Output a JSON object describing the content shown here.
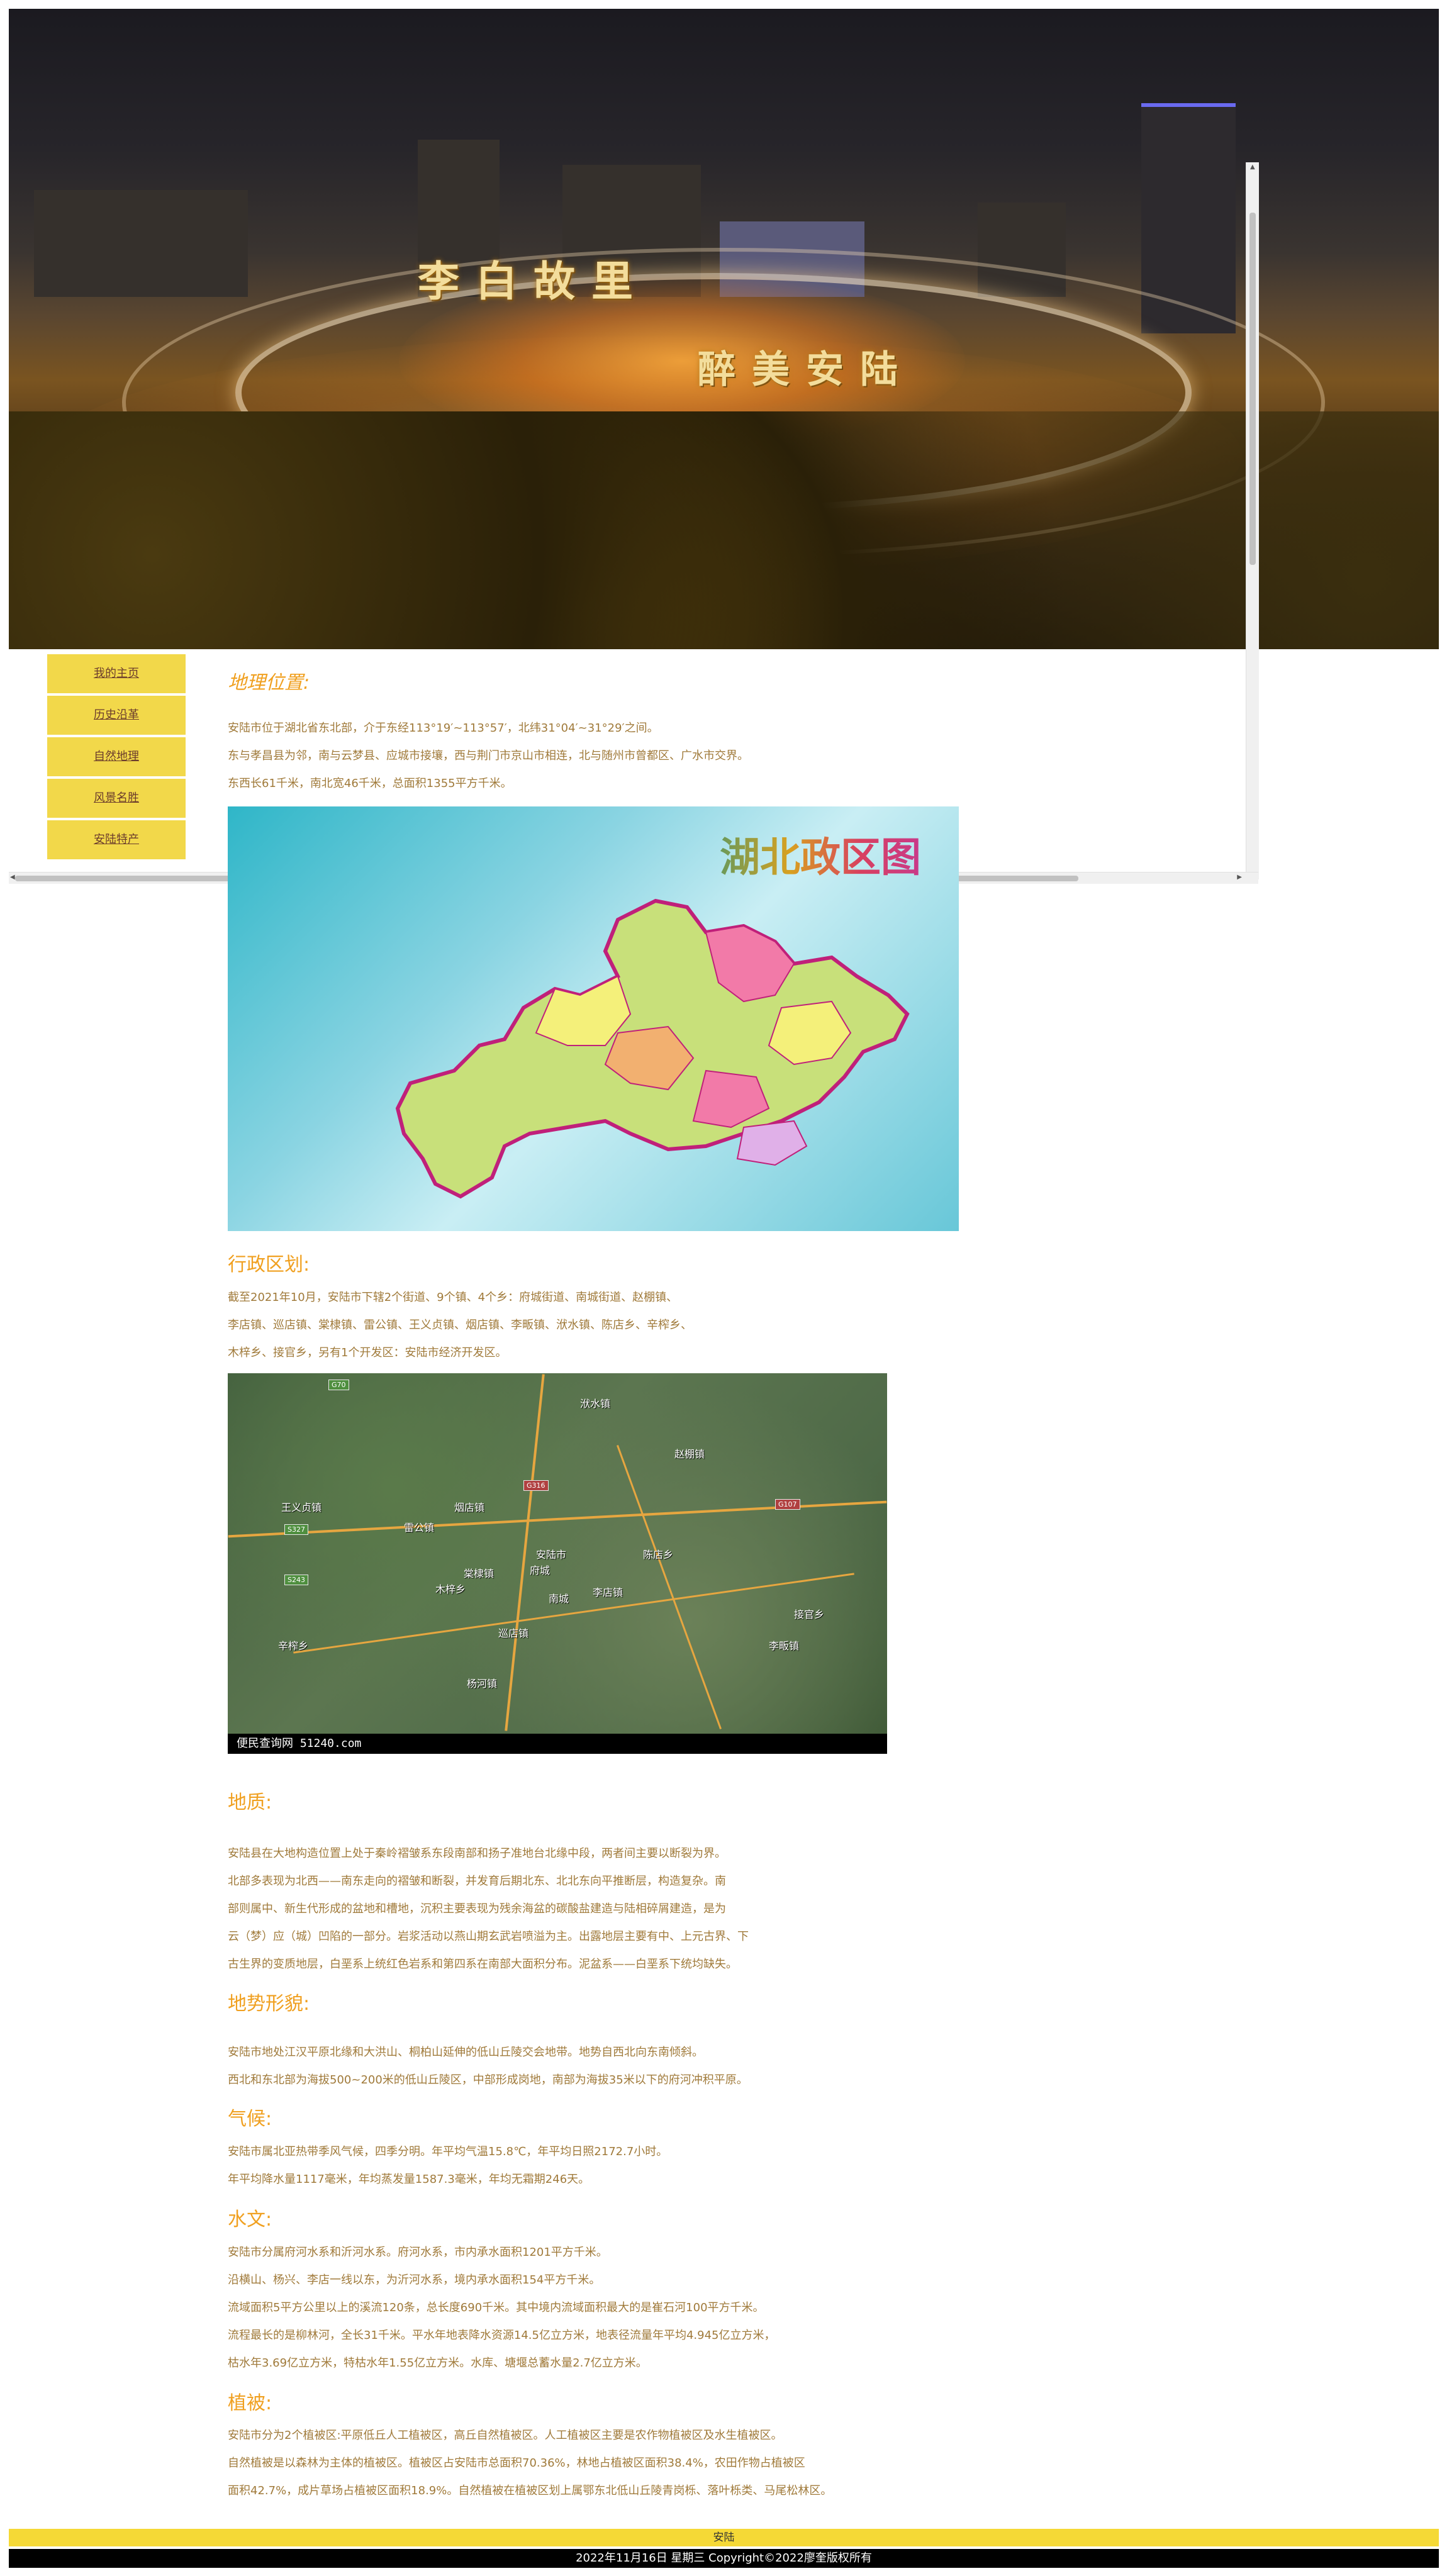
{
  "banner": {
    "title_line1": "李白故里",
    "title_line2": "醉美安陆"
  },
  "nav": {
    "items": [
      {
        "label": "我的主页"
      },
      {
        "label": "历史沿革"
      },
      {
        "label": "自然地理"
      },
      {
        "label": "风景名胜"
      },
      {
        "label": "安陆特产"
      }
    ]
  },
  "sections": {
    "location": {
      "title": "地理位置:",
      "lines": [
        "安陆市位于湖北省东北部，介于东经113°19′~113°57′，北纬31°04′~31°29′之间。",
        "东与孝昌县为邻，南与云梦县、应城市接壤，西与荆门市京山市相连，北与随州市曾都区、广水市交界。",
        "东西长61千米，南北宽46千米，总面积1355平方千米。"
      ]
    },
    "map1": {
      "title": "湖北政区图"
    },
    "admin": {
      "title": "行政区划:",
      "lines": [
        "截至2021年10月，安陆市下辖2个街道、9个镇、4个乡：府城街道、南城街道、赵棚镇、",
        "李店镇、巡店镇、棠棣镇、雷公镇、王义贞镇、烟店镇、李畈镇、洑水镇、陈店乡、辛榨乡、",
        "木梓乡、接官乡，另有1个开发区：安陆市经济开发区。"
      ]
    },
    "map2": {
      "caption": "便民查询网 51240.com",
      "places": [
        "洑水镇",
        "赵棚镇",
        "王义贞镇",
        "雷公镇",
        "烟店镇",
        "棠棣镇",
        "安陆市",
        "府城",
        "南城",
        "李店镇",
        "陈店乡",
        "木梓乡",
        "巡店镇",
        "辛榨乡",
        "杨河镇",
        "李畈镇",
        "接官乡"
      ],
      "roads": [
        "G70",
        "G316",
        "G107",
        "S243",
        "S327"
      ]
    },
    "geology": {
      "title": "地质:",
      "lines": [
        "安陆县在大地构造位置上处于秦岭褶皱系东段南部和扬子准地台北缘中段，两者间主要以断裂为界。",
        "北部多表现为北西——南东走向的褶皱和断裂，并发育后期北东、北北东向平推断层，构造复杂。南",
        "部则属中、新生代形成的盆地和槽地，沉积主要表现为残余海盆的碳酸盐建造与陆相碎屑建造，是为",
        "云（梦）应（城）凹陷的一部分。岩浆活动以燕山期玄武岩喷溢为主。出露地层主要有中、上元古界、下",
        "古生界的变质地层，白垩系上统红色岩系和第四系在南部大面积分布。泥盆系——白垩系下统均缺失。"
      ]
    },
    "terrain": {
      "title": "地势形貌:",
      "lines": [
        "安陆市地处江汉平原北缘和大洪山、桐柏山延伸的低山丘陵交会地带。地势自西北向东南倾斜。",
        "西北和东北部为海拔500~200米的低山丘陵区，中部形成岗地，南部为海拔35米以下的府河冲积平原。"
      ]
    },
    "climate": {
      "title": "气候:",
      "lines": [
        "安陆市属北亚热带季风气候，四季分明。年平均气温15.8℃，年平均日照2172.7小时。",
        "年平均降水量1117毫米，年均蒸发量1587.3毫米，年均无霜期246天。"
      ]
    },
    "hydrology": {
      "title": "水文:",
      "lines": [
        "安陆市分属府河水系和沂河水系。府河水系，市内承水面积1201平方千米。",
        "沿横山、杨兴、李店一线以东，为沂河水系，境内承水面积154平方千米。",
        "流域面积5平方公里以上的溪流120条，总长度690千米。其中境内流域面积最大的是崔石河100平方千米。",
        "流程最长的是柳林河，全长31千米。平水年地表降水资源14.5亿立方米，地表径流量年平均4.945亿立方米，",
        "枯水年3.69亿立方米，特枯水年1.55亿立方米。水库、塘堰总蓄水量2.7亿立方米。"
      ]
    },
    "vegetation": {
      "title": "植被:",
      "lines": [
        "安陆市分为2个植被区:平原低丘人工植被区，高丘自然植被区。人工植被区主要是农作物植被区及水生植被区。",
        "自然植被是以森林为主体的植被区。植被区占安陆市总面积70.36%，林地占植被区面积38.4%，农田作物占植被区",
        "面积42.7%，成片草场占植被区面积18.9%。自然植被在植被区划上属鄂东北低山丘陵青岗栎、落叶栎类、马尾松林区。"
      ]
    }
  },
  "footer": {
    "bar_text": "安陆",
    "copyright": "2022年11月16日 星期三 Copyright©2022廖奎版权所有"
  },
  "colors": {
    "accent_yellow": "#f2d84a",
    "heading_orange": "#f0a020",
    "body_brown": "#a07a3a"
  }
}
